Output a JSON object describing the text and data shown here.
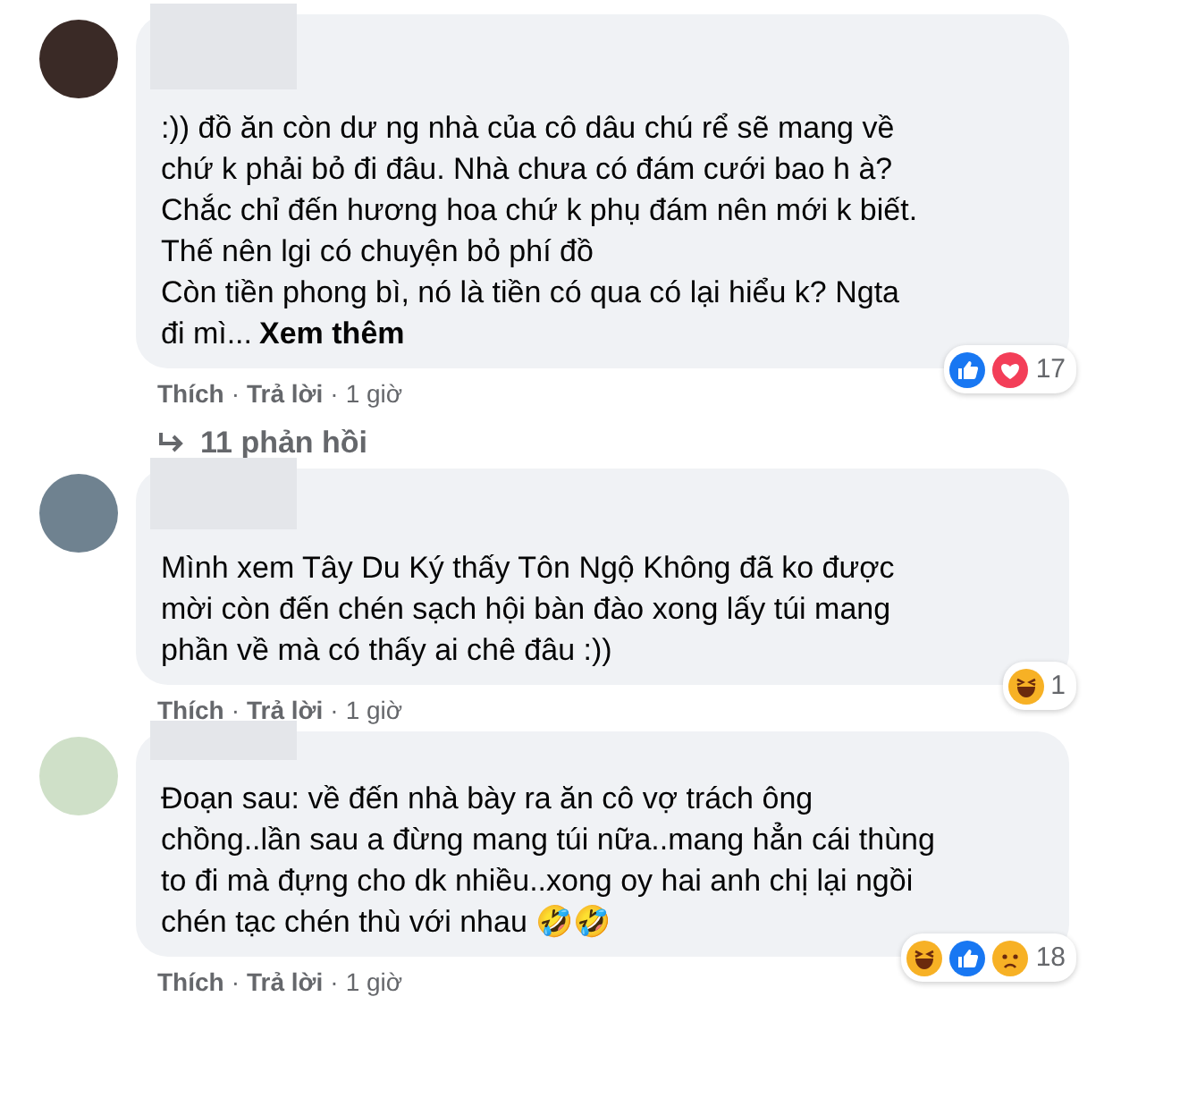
{
  "comments": [
    {
      "lines": [
        ":)) đồ ăn còn dư ng nhà của cô dâu chú rể sẽ mang về",
        "chứ k phải bỏ đi đâu. Nhà chưa có đám cưới bao h à?",
        "Chắc chỉ đến hương hoa chứ k phụ đám nên mới k biết.",
        "Thế nên lgi có chuyện bỏ phí đồ",
        "Còn tiền phong bì, nó là tiền có qua có lại hiểu k? Ngta",
        "đi mì..."
      ],
      "see_more": "Xem thêm",
      "reactions": [
        {
          "kind": "like"
        },
        {
          "kind": "love"
        }
      ],
      "reaction_count": "17",
      "actions": [
        "Thích",
        "Trả lời"
      ],
      "separator": "·",
      "time": "1 giờ",
      "replies": "11 phản hồi"
    },
    {
      "lines": [
        "Mình xem Tây Du Ký thấy Tôn Ngộ Không đã ko được",
        "mời còn đến chén sạch hội bàn đào xong lấy túi mang",
        "phần về mà có thấy ai chê đâu :))"
      ],
      "reactions": [
        {
          "kind": "haha"
        }
      ],
      "reaction_count": "1",
      "actions": [
        "Thích",
        "Trả lời"
      ],
      "separator": "·",
      "time": "1 giờ"
    },
    {
      "lines": [
        "Đoạn sau: về đến nhà bày ra ăn cô vợ trách ông",
        "chồng..lần sau a đừng mang túi nữa..mang hẳn cái thùng",
        "to đi mà đựng cho dk nhiều..xong oy hai anh chị lại ngồi",
        "chén tạc chén thù với nhau 🤣🤣"
      ],
      "reactions": [
        {
          "kind": "haha"
        },
        {
          "kind": "like"
        },
        {
          "kind": "sad"
        }
      ],
      "reaction_count": "18",
      "actions": [
        "Thích",
        "Trả lời"
      ],
      "separator": "·",
      "time": "1 giờ"
    }
  ]
}
